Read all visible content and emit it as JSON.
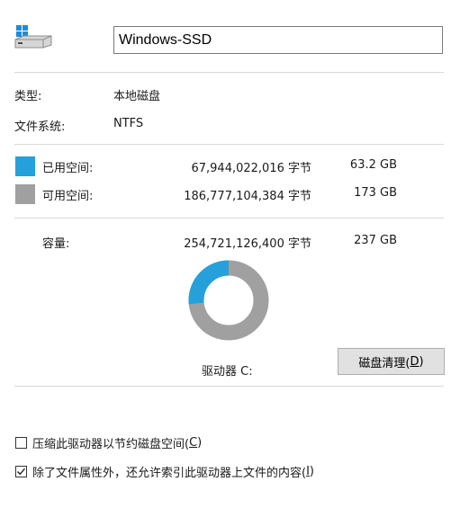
{
  "drive_name": "Windows-SSD",
  "props": {
    "type_label": "类型:",
    "type_value": "本地磁盘",
    "fs_label": "文件系统:",
    "fs_value": "NTFS"
  },
  "used": {
    "label": "已用空间:",
    "bytes": "67,944,022,016 字节",
    "size": "63.2 GB",
    "color": "#26a0da"
  },
  "free": {
    "label": "可用空间:",
    "bytes": "186,777,104,384 字节",
    "size": "173 GB",
    "color": "#a0a0a0"
  },
  "capacity": {
    "label": "容量:",
    "bytes": "254,721,126,400 字节",
    "size": "237 GB"
  },
  "usage_fraction": 0.2667,
  "drive_label": "驱动器 C:",
  "cleanup": {
    "text": "磁盘清理(",
    "key": "D",
    "end": ")"
  },
  "options": {
    "compress": {
      "text": "压缩此驱动器以节约磁盘空间(",
      "key": "C",
      "end": ")",
      "checked": false
    },
    "index": {
      "text": "除了文件属性外，还允许索引此驱动器上文件的内容(",
      "key": "I",
      "end": ")",
      "checked": true
    }
  },
  "icons": {
    "drive": "drive-icon",
    "windows_logo": "windows-logo-icon",
    "check": "check-icon"
  }
}
